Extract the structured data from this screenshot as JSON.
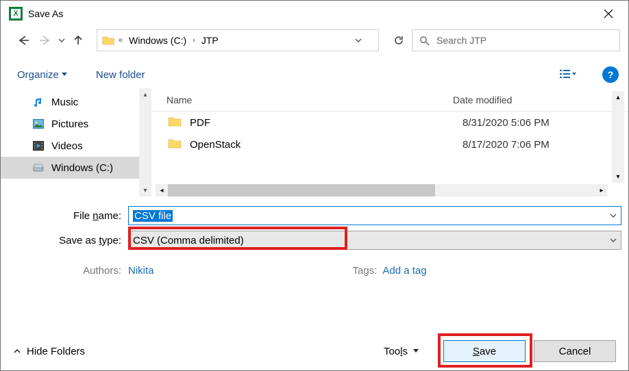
{
  "title": "Save As",
  "breadcrumb": {
    "seg1": "Windows (C:)",
    "seg2": "JTP"
  },
  "search": {
    "placeholder": "Search JTP"
  },
  "toolbar": {
    "organize": "Organize",
    "new_folder": "New folder"
  },
  "sidebar": {
    "items": [
      {
        "label": "Music"
      },
      {
        "label": "Pictures"
      },
      {
        "label": "Videos"
      },
      {
        "label": "Windows (C:)"
      }
    ]
  },
  "columns": {
    "name": "Name",
    "date": "Date modified"
  },
  "files": [
    {
      "name": "PDF",
      "date": "8/31/2020 5:06 PM"
    },
    {
      "name": "OpenStack",
      "date": "8/17/2020 7:06 PM"
    }
  ],
  "form": {
    "filename_label": "File name:",
    "filename_value": "CSV file",
    "saveas_label": "Save as type:",
    "saveas_value": "CSV (Comma delimited)",
    "authors_label": "Authors:",
    "authors_value": "Nikita",
    "tags_label": "Tags:",
    "tags_value": "Add a tag"
  },
  "bottom": {
    "hide_folders": "Hide Folders",
    "tools": "Tools",
    "save": "Save",
    "cancel": "Cancel"
  }
}
